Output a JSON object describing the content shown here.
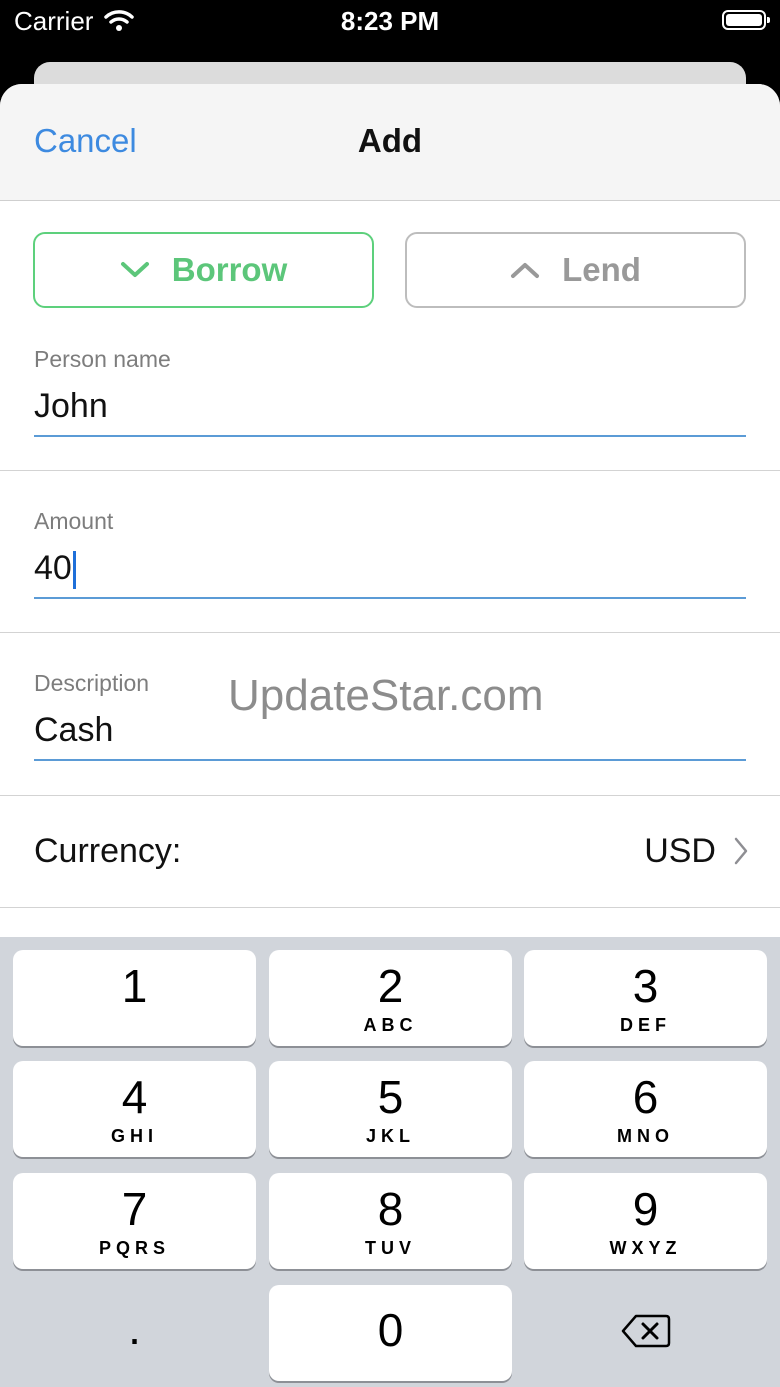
{
  "status_bar": {
    "carrier": "Carrier",
    "time": "8:23 PM"
  },
  "nav": {
    "cancel": "Cancel",
    "title": "Add"
  },
  "segments": {
    "borrow": "Borrow",
    "lend": "Lend",
    "selected": "Borrow"
  },
  "fields": {
    "person": {
      "label": "Person name",
      "value": "John"
    },
    "amount": {
      "label": "Amount",
      "value": "40"
    },
    "description": {
      "label": "Description",
      "value": "Cash"
    }
  },
  "currency": {
    "label": "Currency:",
    "value": "USD"
  },
  "watermark": "UpdateStar.com",
  "keypad": {
    "keys": [
      {
        "num": "1",
        "letters": ""
      },
      {
        "num": "2",
        "letters": "ABC"
      },
      {
        "num": "3",
        "letters": "DEF"
      },
      {
        "num": "4",
        "letters": "GHI"
      },
      {
        "num": "5",
        "letters": "JKL"
      },
      {
        "num": "6",
        "letters": "MNO"
      },
      {
        "num": "7",
        "letters": "PQRS"
      },
      {
        "num": "8",
        "letters": "TUV"
      },
      {
        "num": "9",
        "letters": "WXYZ"
      }
    ],
    "decimal": ".",
    "zero": "0"
  },
  "colors": {
    "accent": "#3d8ae0",
    "borrow": "#5cc67a",
    "lend": "#999999"
  }
}
